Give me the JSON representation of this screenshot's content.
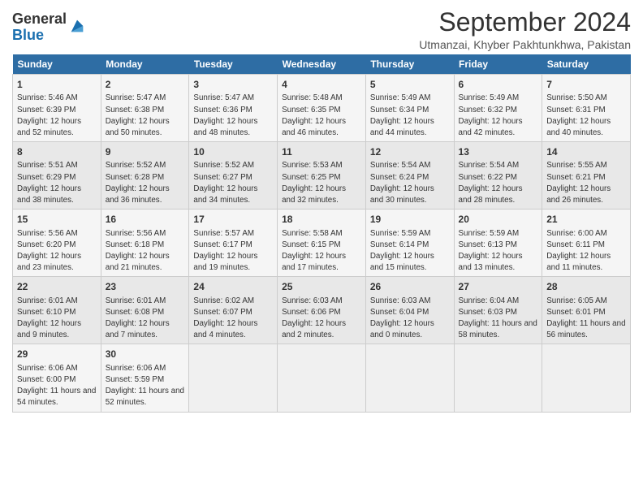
{
  "header": {
    "logo_line1": "General",
    "logo_line2": "Blue",
    "month": "September 2024",
    "location": "Utmanzai, Khyber Pakhtunkhwa, Pakistan"
  },
  "days_of_week": [
    "Sunday",
    "Monday",
    "Tuesday",
    "Wednesday",
    "Thursday",
    "Friday",
    "Saturday"
  ],
  "weeks": [
    [
      {
        "day": "1",
        "sunrise": "Sunrise: 5:46 AM",
        "sunset": "Sunset: 6:39 PM",
        "daylight": "Daylight: 12 hours and 52 minutes."
      },
      {
        "day": "2",
        "sunrise": "Sunrise: 5:47 AM",
        "sunset": "Sunset: 6:38 PM",
        "daylight": "Daylight: 12 hours and 50 minutes."
      },
      {
        "day": "3",
        "sunrise": "Sunrise: 5:47 AM",
        "sunset": "Sunset: 6:36 PM",
        "daylight": "Daylight: 12 hours and 48 minutes."
      },
      {
        "day": "4",
        "sunrise": "Sunrise: 5:48 AM",
        "sunset": "Sunset: 6:35 PM",
        "daylight": "Daylight: 12 hours and 46 minutes."
      },
      {
        "day": "5",
        "sunrise": "Sunrise: 5:49 AM",
        "sunset": "Sunset: 6:34 PM",
        "daylight": "Daylight: 12 hours and 44 minutes."
      },
      {
        "day": "6",
        "sunrise": "Sunrise: 5:49 AM",
        "sunset": "Sunset: 6:32 PM",
        "daylight": "Daylight: 12 hours and 42 minutes."
      },
      {
        "day": "7",
        "sunrise": "Sunrise: 5:50 AM",
        "sunset": "Sunset: 6:31 PM",
        "daylight": "Daylight: 12 hours and 40 minutes."
      }
    ],
    [
      {
        "day": "8",
        "sunrise": "Sunrise: 5:51 AM",
        "sunset": "Sunset: 6:29 PM",
        "daylight": "Daylight: 12 hours and 38 minutes."
      },
      {
        "day": "9",
        "sunrise": "Sunrise: 5:52 AM",
        "sunset": "Sunset: 6:28 PM",
        "daylight": "Daylight: 12 hours and 36 minutes."
      },
      {
        "day": "10",
        "sunrise": "Sunrise: 5:52 AM",
        "sunset": "Sunset: 6:27 PM",
        "daylight": "Daylight: 12 hours and 34 minutes."
      },
      {
        "day": "11",
        "sunrise": "Sunrise: 5:53 AM",
        "sunset": "Sunset: 6:25 PM",
        "daylight": "Daylight: 12 hours and 32 minutes."
      },
      {
        "day": "12",
        "sunrise": "Sunrise: 5:54 AM",
        "sunset": "Sunset: 6:24 PM",
        "daylight": "Daylight: 12 hours and 30 minutes."
      },
      {
        "day": "13",
        "sunrise": "Sunrise: 5:54 AM",
        "sunset": "Sunset: 6:22 PM",
        "daylight": "Daylight: 12 hours and 28 minutes."
      },
      {
        "day": "14",
        "sunrise": "Sunrise: 5:55 AM",
        "sunset": "Sunset: 6:21 PM",
        "daylight": "Daylight: 12 hours and 26 minutes."
      }
    ],
    [
      {
        "day": "15",
        "sunrise": "Sunrise: 5:56 AM",
        "sunset": "Sunset: 6:20 PM",
        "daylight": "Daylight: 12 hours and 23 minutes."
      },
      {
        "day": "16",
        "sunrise": "Sunrise: 5:56 AM",
        "sunset": "Sunset: 6:18 PM",
        "daylight": "Daylight: 12 hours and 21 minutes."
      },
      {
        "day": "17",
        "sunrise": "Sunrise: 5:57 AM",
        "sunset": "Sunset: 6:17 PM",
        "daylight": "Daylight: 12 hours and 19 minutes."
      },
      {
        "day": "18",
        "sunrise": "Sunrise: 5:58 AM",
        "sunset": "Sunset: 6:15 PM",
        "daylight": "Daylight: 12 hours and 17 minutes."
      },
      {
        "day": "19",
        "sunrise": "Sunrise: 5:59 AM",
        "sunset": "Sunset: 6:14 PM",
        "daylight": "Daylight: 12 hours and 15 minutes."
      },
      {
        "day": "20",
        "sunrise": "Sunrise: 5:59 AM",
        "sunset": "Sunset: 6:13 PM",
        "daylight": "Daylight: 12 hours and 13 minutes."
      },
      {
        "day": "21",
        "sunrise": "Sunrise: 6:00 AM",
        "sunset": "Sunset: 6:11 PM",
        "daylight": "Daylight: 12 hours and 11 minutes."
      }
    ],
    [
      {
        "day": "22",
        "sunrise": "Sunrise: 6:01 AM",
        "sunset": "Sunset: 6:10 PM",
        "daylight": "Daylight: 12 hours and 9 minutes."
      },
      {
        "day": "23",
        "sunrise": "Sunrise: 6:01 AM",
        "sunset": "Sunset: 6:08 PM",
        "daylight": "Daylight: 12 hours and 7 minutes."
      },
      {
        "day": "24",
        "sunrise": "Sunrise: 6:02 AM",
        "sunset": "Sunset: 6:07 PM",
        "daylight": "Daylight: 12 hours and 4 minutes."
      },
      {
        "day": "25",
        "sunrise": "Sunrise: 6:03 AM",
        "sunset": "Sunset: 6:06 PM",
        "daylight": "Daylight: 12 hours and 2 minutes."
      },
      {
        "day": "26",
        "sunrise": "Sunrise: 6:03 AM",
        "sunset": "Sunset: 6:04 PM",
        "daylight": "Daylight: 12 hours and 0 minutes."
      },
      {
        "day": "27",
        "sunrise": "Sunrise: 6:04 AM",
        "sunset": "Sunset: 6:03 PM",
        "daylight": "Daylight: 11 hours and 58 minutes."
      },
      {
        "day": "28",
        "sunrise": "Sunrise: 6:05 AM",
        "sunset": "Sunset: 6:01 PM",
        "daylight": "Daylight: 11 hours and 56 minutes."
      }
    ],
    [
      {
        "day": "29",
        "sunrise": "Sunrise: 6:06 AM",
        "sunset": "Sunset: 6:00 PM",
        "daylight": "Daylight: 11 hours and 54 minutes."
      },
      {
        "day": "30",
        "sunrise": "Sunrise: 6:06 AM",
        "sunset": "Sunset: 5:59 PM",
        "daylight": "Daylight: 11 hours and 52 minutes."
      },
      {
        "day": "",
        "sunrise": "",
        "sunset": "",
        "daylight": ""
      },
      {
        "day": "",
        "sunrise": "",
        "sunset": "",
        "daylight": ""
      },
      {
        "day": "",
        "sunrise": "",
        "sunset": "",
        "daylight": ""
      },
      {
        "day": "",
        "sunrise": "",
        "sunset": "",
        "daylight": ""
      },
      {
        "day": "",
        "sunrise": "",
        "sunset": "",
        "daylight": ""
      }
    ]
  ]
}
